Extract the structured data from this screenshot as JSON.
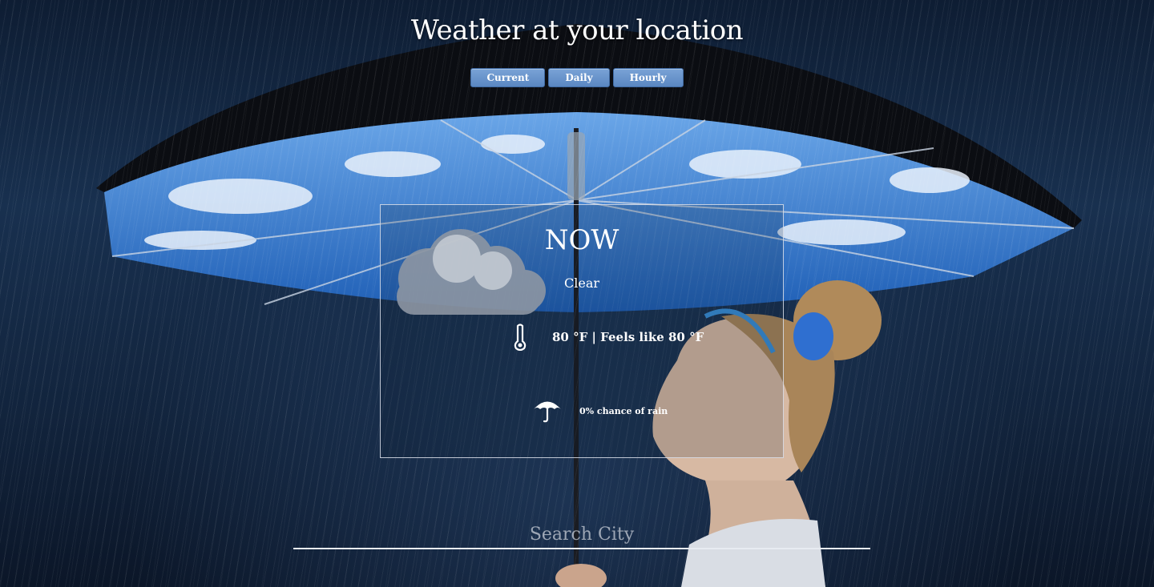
{
  "header": {
    "title": "Weather at your location"
  },
  "tabs": [
    {
      "label": "Current"
    },
    {
      "label": "Daily"
    },
    {
      "label": "Hourly"
    }
  ],
  "card": {
    "title": "NOW",
    "condition": "Clear",
    "temperature": "80 °F | Feels like 80 °F",
    "rain_chance": "0% chance of rain",
    "icons": [
      "thermometer-icon",
      "umbrella-icon"
    ]
  },
  "search": {
    "placeholder": "Search City"
  }
}
